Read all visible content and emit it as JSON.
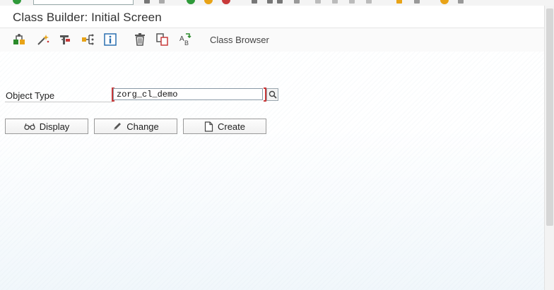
{
  "window": {
    "title": "Class Builder: Initial Screen"
  },
  "toolbar": {
    "icons": [
      "other-object-icon",
      "wizard-icon",
      "where-used-icon",
      "hierarchy-icon",
      "info-icon",
      "delete-icon",
      "copy-icon",
      "rename-icon"
    ],
    "class_browser_label": "Class Browser"
  },
  "form": {
    "object_type_label": "Object Type",
    "object_type_value": "zorg_cl_demo"
  },
  "buttons": {
    "display_label": "Display",
    "change_label": "Change",
    "create_label": "Create"
  },
  "colors": {
    "required_bracket": "#c83a3a",
    "accent_green": "#2a8a2a",
    "accent_orange": "#e8a317"
  }
}
